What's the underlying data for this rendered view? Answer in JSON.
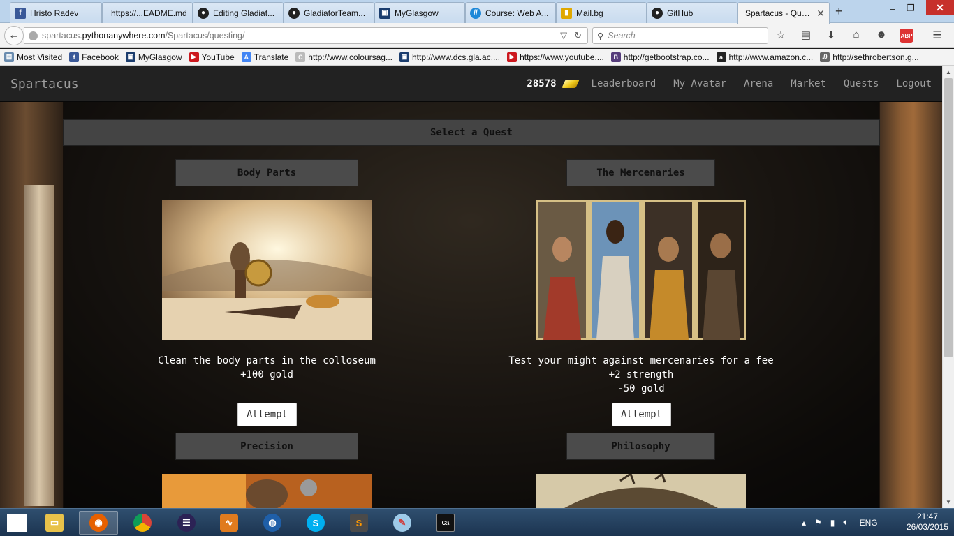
{
  "browser": {
    "tabs": [
      {
        "label": "Hristo Radev",
        "icon": "facebook-icon",
        "color": "#3b5998",
        "glyph": "f"
      },
      {
        "label": "https://...EADME.md",
        "icon": "blank-page-icon",
        "color": "#cccccc",
        "glyph": ""
      },
      {
        "label": "Editing Gladiat...",
        "icon": "github-icon",
        "color": "#222222",
        "glyph": "●"
      },
      {
        "label": "GladiatorTeam...",
        "icon": "github-icon",
        "color": "#222222",
        "glyph": "●"
      },
      {
        "label": "MyGlasgow",
        "icon": "myglasgow-icon",
        "color": "#1b3d6e",
        "glyph": "▣"
      },
      {
        "label": "Course: Web A...",
        "icon": "moodle-icon",
        "color": "#1e88d8",
        "glyph": "//"
      },
      {
        "label": "Mail.bg",
        "icon": "mail-bg-icon",
        "color": "#e0a800",
        "glyph": "▮"
      },
      {
        "label": "GitHub",
        "icon": "github-icon",
        "color": "#222222",
        "glyph": "●"
      },
      {
        "label": "Spartacus - Que...",
        "icon": "",
        "color": "",
        "glyph": ""
      }
    ],
    "url": {
      "prefix": "spartacus.",
      "domain": "pythonanywhere.com",
      "path": "/Spartacus/questing/"
    },
    "search_placeholder": "Search",
    "bookmarks": [
      {
        "label": "Most Visited",
        "icon": "most-visited-icon",
        "color": "#6a8caf",
        "glyph": "▤"
      },
      {
        "label": "Facebook",
        "icon": "facebook-icon",
        "color": "#3b5998",
        "glyph": "f"
      },
      {
        "label": "MyGlasgow",
        "icon": "myglasgow-icon",
        "color": "#1b3d6e",
        "glyph": "▣"
      },
      {
        "label": "YouTube",
        "icon": "youtube-icon",
        "color": "#cc181e",
        "glyph": "▶"
      },
      {
        "label": "Translate",
        "icon": "translate-icon",
        "color": "#4285f4",
        "glyph": "A"
      },
      {
        "label": "http://www.coloursag...",
        "icon": "coloursag-icon",
        "color": "#bbbbbb",
        "glyph": "C"
      },
      {
        "label": "http://www.dcs.gla.ac....",
        "icon": "gla-icon",
        "color": "#1b3d6e",
        "glyph": "▣"
      },
      {
        "label": "https://www.youtube....",
        "icon": "youtube-icon",
        "color": "#cc181e",
        "glyph": "▶"
      },
      {
        "label": "http://getbootstrap.co...",
        "icon": "bootstrap-icon",
        "color": "#563d7c",
        "glyph": "B"
      },
      {
        "label": "http://www.amazon.c...",
        "icon": "amazon-icon",
        "color": "#222222",
        "glyph": "a"
      },
      {
        "label": "http://sethrobertson.g...",
        "icon": "seth-icon",
        "color": "#666666",
        "glyph": "Ꭿ"
      }
    ]
  },
  "site": {
    "brand": "Spartacus",
    "gold": "28578",
    "nav": [
      "Leaderboard",
      "My Avatar",
      "Arena",
      "Market",
      "Quests",
      "Logout"
    ]
  },
  "quests_panel": {
    "heading": "Select a Quest",
    "attempt_label": "Attempt",
    "quests": [
      {
        "title": "Body Parts",
        "lines": [
          "Clean the body parts in the colloseum",
          "+100 gold"
        ]
      },
      {
        "title": "The Mercenaries",
        "lines": [
          "Test your might against mercenaries for a fee",
          "+2 strength",
          "-50 gold"
        ]
      },
      {
        "title": "Precision",
        "lines": []
      },
      {
        "title": "Philosophy",
        "lines": []
      }
    ]
  },
  "taskbar": {
    "apps": [
      {
        "name": "file-explorer-icon",
        "color": "#e8c24a",
        "glyph": "▭"
      },
      {
        "name": "firefox-icon",
        "color": "#e66000",
        "glyph": "◉",
        "active": true
      },
      {
        "name": "chrome-icon",
        "color": "#2e9a4a",
        "glyph": "◎"
      },
      {
        "name": "eclipse-icon",
        "color": "#2c2255",
        "glyph": "☰"
      },
      {
        "name": "matlab-icon",
        "color": "#e07b1e",
        "glyph": "∿"
      },
      {
        "name": "app-globe-icon",
        "color": "#1f5fa8",
        "glyph": "◍"
      },
      {
        "name": "skype-icon",
        "color": "#00aff0",
        "glyph": "S"
      },
      {
        "name": "sublime-text-icon",
        "color": "#ff9800",
        "glyph": "S"
      },
      {
        "name": "paint-icon",
        "color": "#9ecae8",
        "glyph": "✎"
      },
      {
        "name": "command-prompt-icon",
        "color": "#111111",
        "glyph": "C:\\"
      }
    ],
    "language": "ENG",
    "time": "21:47",
    "date": "26/03/2015"
  }
}
